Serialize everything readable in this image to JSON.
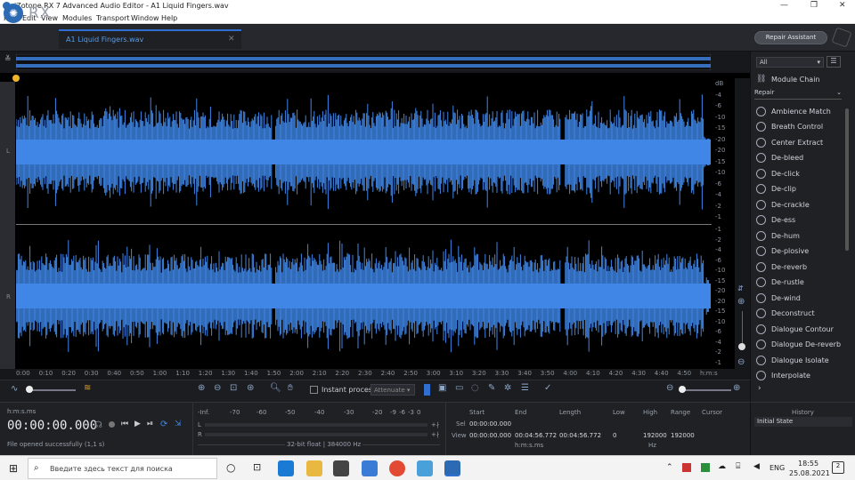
{
  "window": {
    "title": "iZotope RX 7 Advanced Audio Editor - A1 Liquid Fingers.wav",
    "controls": [
      "—",
      "❐",
      "✕"
    ]
  },
  "menu": [
    "File",
    "Edit",
    "View",
    "Modules",
    "Transport",
    "Window",
    "Help"
  ],
  "header": {
    "logo_text": "RX",
    "tab_name": "A1 Liquid Fingers.wav",
    "tab_close": "✕",
    "repair_assistant": "Repair Assistant"
  },
  "channels": {
    "left": "L",
    "right": "R"
  },
  "db_scale_top": [
    "dB",
    "-4",
    "-6",
    "-10",
    "-15",
    "-20",
    "-20",
    "-15",
    "-10",
    "-6",
    "-4",
    "-2",
    "-1"
  ],
  "db_scale_bottom": [
    "-1",
    "-2",
    "-4",
    "-6",
    "-10",
    "-15",
    "-20",
    "-20",
    "-15",
    "-10",
    "-6",
    "-4",
    "-2",
    "-1"
  ],
  "time_ticks": [
    "0:00",
    "0:10",
    "0:20",
    "0:30",
    "0:40",
    "0:50",
    "1:00",
    "1:10",
    "1:20",
    "1:30",
    "1:40",
    "1:50",
    "2:00",
    "2:10",
    "2:20",
    "2:30",
    "2:40",
    "2:50",
    "3:00",
    "3:10",
    "3:20",
    "3:30",
    "3:40",
    "3:50",
    "4:00",
    "4:10",
    "4:20",
    "4:30",
    "4:40",
    "4:50",
    "h:m:s"
  ],
  "tools": {
    "instant_process": "Instant process",
    "attenuate": "Attenuate"
  },
  "panel": {
    "filter": "All",
    "module_chain": "Module Chain",
    "category": "Repair",
    "modules": [
      "Ambience Match",
      "Breath Control",
      "Center Extract",
      "De-bleed",
      "De-click",
      "De-clip",
      "De-crackle",
      "De-ess",
      "De-hum",
      "De-plosive",
      "De-reverb",
      "De-rustle",
      "De-wind",
      "Deconstruct",
      "Dialogue Contour",
      "Dialogue De-reverb",
      "Dialogue Isolate",
      "Interpolate"
    ]
  },
  "transport": {
    "format": "h:m:s.ms",
    "time": "00:00:00.000",
    "status": "File opened successfully (1,1 s)"
  },
  "meter": {
    "scale": [
      "-Inf.",
      "-70",
      "-60",
      "-50",
      "-40",
      "-30",
      "-20",
      "-9",
      "-6",
      "-3",
      "0"
    ],
    "L": "L",
    "R": "R",
    "info": "32-bit float | 384000 Hz"
  },
  "selection": {
    "headers": [
      "Start",
      "End",
      "Length",
      "Low",
      "High",
      "Range",
      "Cursor"
    ],
    "sel_label": "Sel",
    "view_label": "View",
    "sel_start": "00:00:00.000",
    "view_start": "00:00:00.000",
    "view_end": "00:04:56.772",
    "view_length": "00:04:56.772",
    "low": "0",
    "high": "192000",
    "range": "192000",
    "unit_time": "h:m:s.ms",
    "unit_hz": "Hz"
  },
  "history": {
    "title": "History",
    "item": "Initial State"
  },
  "taskbar": {
    "search": "Введите здесь текст для поиска",
    "lang": "ENG",
    "time": "18:55",
    "date": "25.08.2021",
    "notif": "2"
  },
  "colors": {
    "waveform": "#3f86e6",
    "accent": "#2e6fd0",
    "bg": "#000000"
  }
}
